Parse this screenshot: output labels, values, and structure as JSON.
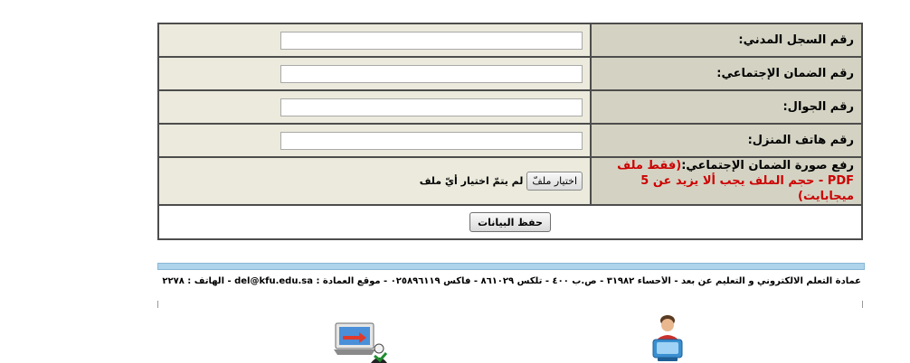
{
  "form": {
    "fields": [
      {
        "label": "رقم السجل المدني:",
        "value": ""
      },
      {
        "label": "رقم الضمان الإجتماعي:",
        "value": ""
      },
      {
        "label": "رقم الجوال:",
        "value": ""
      },
      {
        "label": "رقم هاتف المنزل:",
        "value": ""
      }
    ],
    "upload": {
      "label": "رفع صورة الضمان الإجتماعي:",
      "note": "(فقط ملف PDF - حجم الملف يجب ألا يزيد عن 5 ميجابايت)",
      "button_label": "اختيار ملفّ",
      "status": "لم يتمّ اختيار أيّ ملف"
    },
    "submit_label": "حفظ البيانات"
  },
  "footer": {
    "text": "عمادة التعلم الالكتروني و التعليم عن بعد - الأحساء ٣١٩٨٢ - ص.ب ٤٠٠ - تلكس ٨٦١٠٢٩ - فاكس ٠٢٥٨٩٦١١٩ - موقع العمادة : del@kfu.edu.sa - الهاتف : ٠٠٩٦٦٣٥٨٠٢٢٧٨ - ٠٢٥٨٩٥٦٦٤"
  },
  "icons": {
    "user_icon": "user-at-computer-icon",
    "laptop_icon": "laptop-user-icon"
  }
}
